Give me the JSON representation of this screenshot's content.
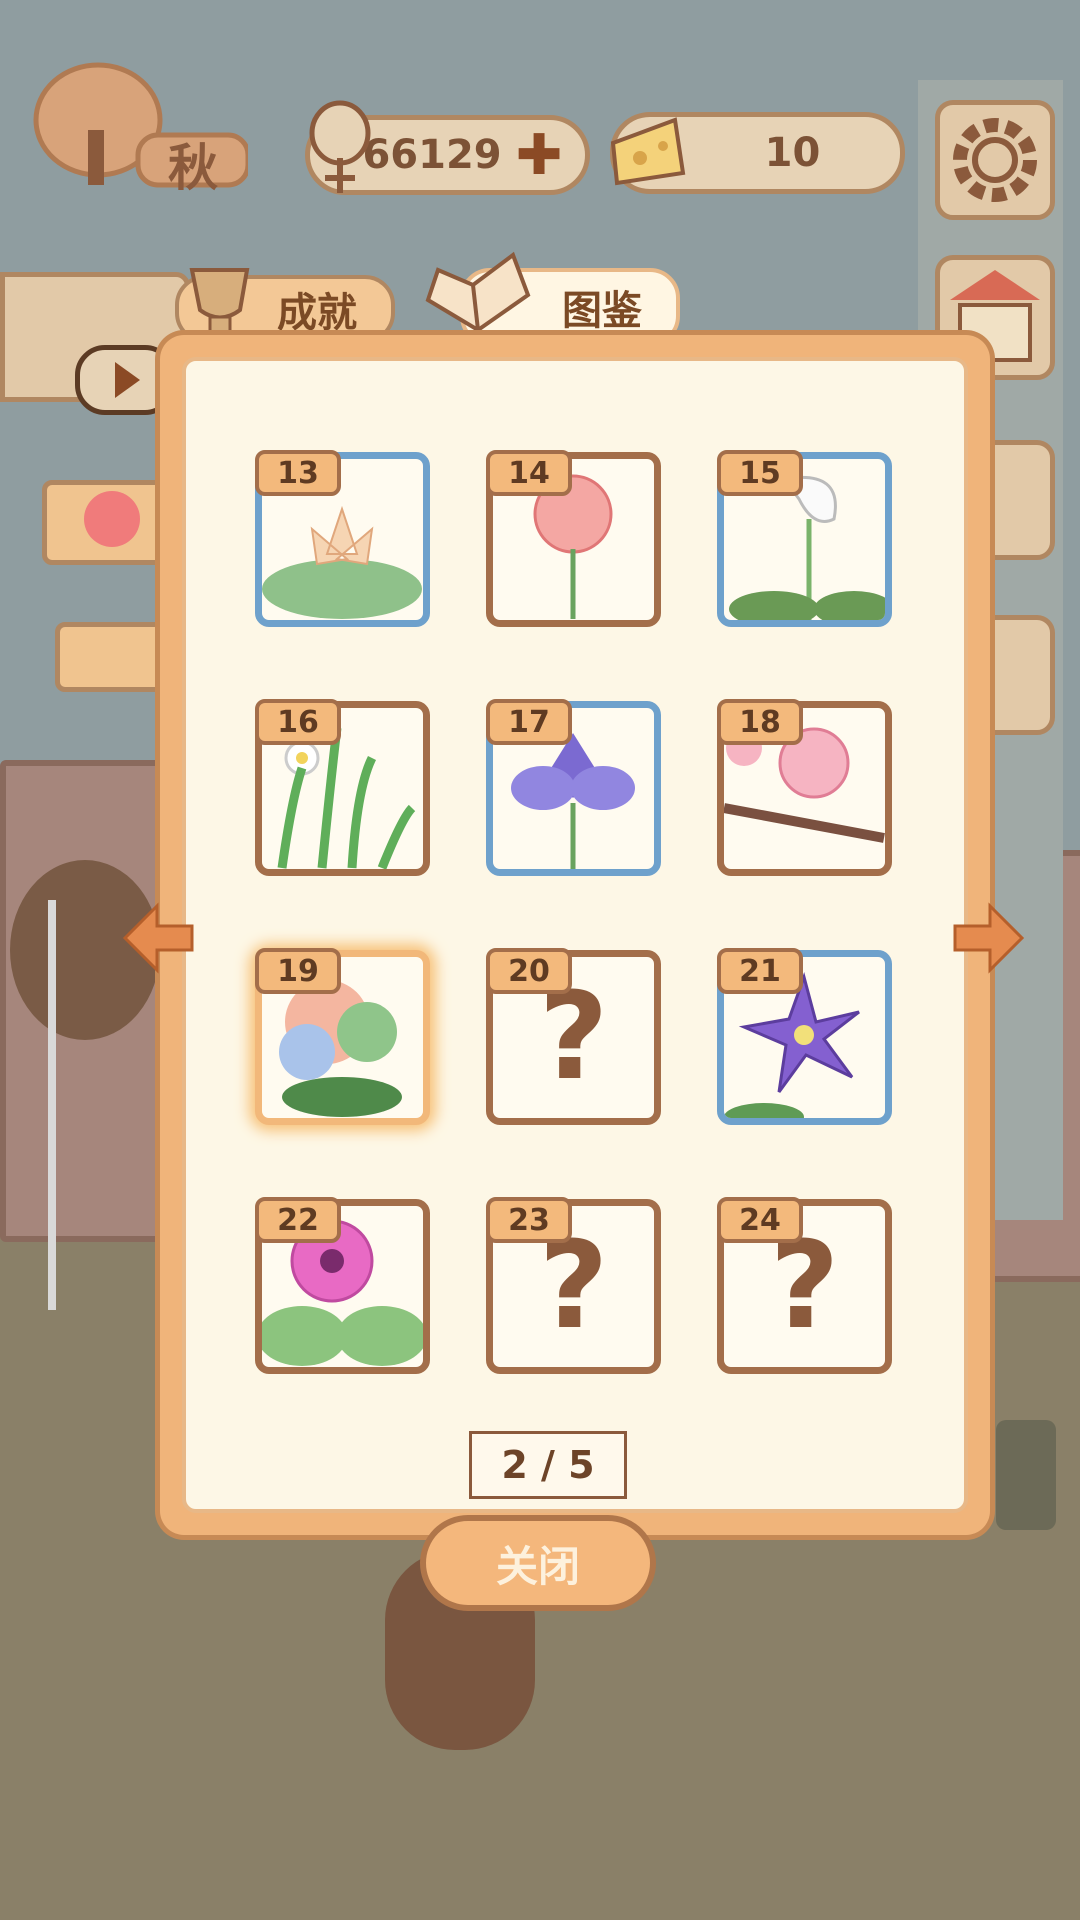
{
  "hud": {
    "season": "秋",
    "fish_coins": "66129",
    "cheese": "10"
  },
  "tabs": {
    "achievements": "成就",
    "encyclopedia": "图鉴"
  },
  "cards": [
    {
      "num": "13",
      "frame": "blue",
      "item": "water-lily"
    },
    {
      "num": "14",
      "frame": "brown",
      "item": "carnation"
    },
    {
      "num": "15",
      "frame": "blue",
      "item": "calla-lily"
    },
    {
      "num": "16",
      "frame": "brown",
      "item": "narcissus"
    },
    {
      "num": "17",
      "frame": "blue",
      "item": "iris"
    },
    {
      "num": "18",
      "frame": "brown",
      "item": "peach-blossom"
    },
    {
      "num": "19",
      "frame": "glow",
      "item": "rainbow-rose"
    },
    {
      "num": "20",
      "frame": "brown",
      "item": "unknown",
      "mark": "?"
    },
    {
      "num": "21",
      "frame": "blue",
      "item": "clematis"
    },
    {
      "num": "22",
      "frame": "brown",
      "item": "gerbera"
    },
    {
      "num": "23",
      "frame": "brown",
      "item": "unknown",
      "mark": "?"
    },
    {
      "num": "24",
      "frame": "brown",
      "item": "unknown",
      "mark": "?"
    }
  ],
  "pager": "2 / 5",
  "close_label": "关闭",
  "colors": {
    "panel": "#f0b47a",
    "panel_inner": "#fdf7e6",
    "frame_brown": "#a36e4a",
    "frame_blue": "#6ea1cc",
    "accent": "#f4b77c"
  }
}
